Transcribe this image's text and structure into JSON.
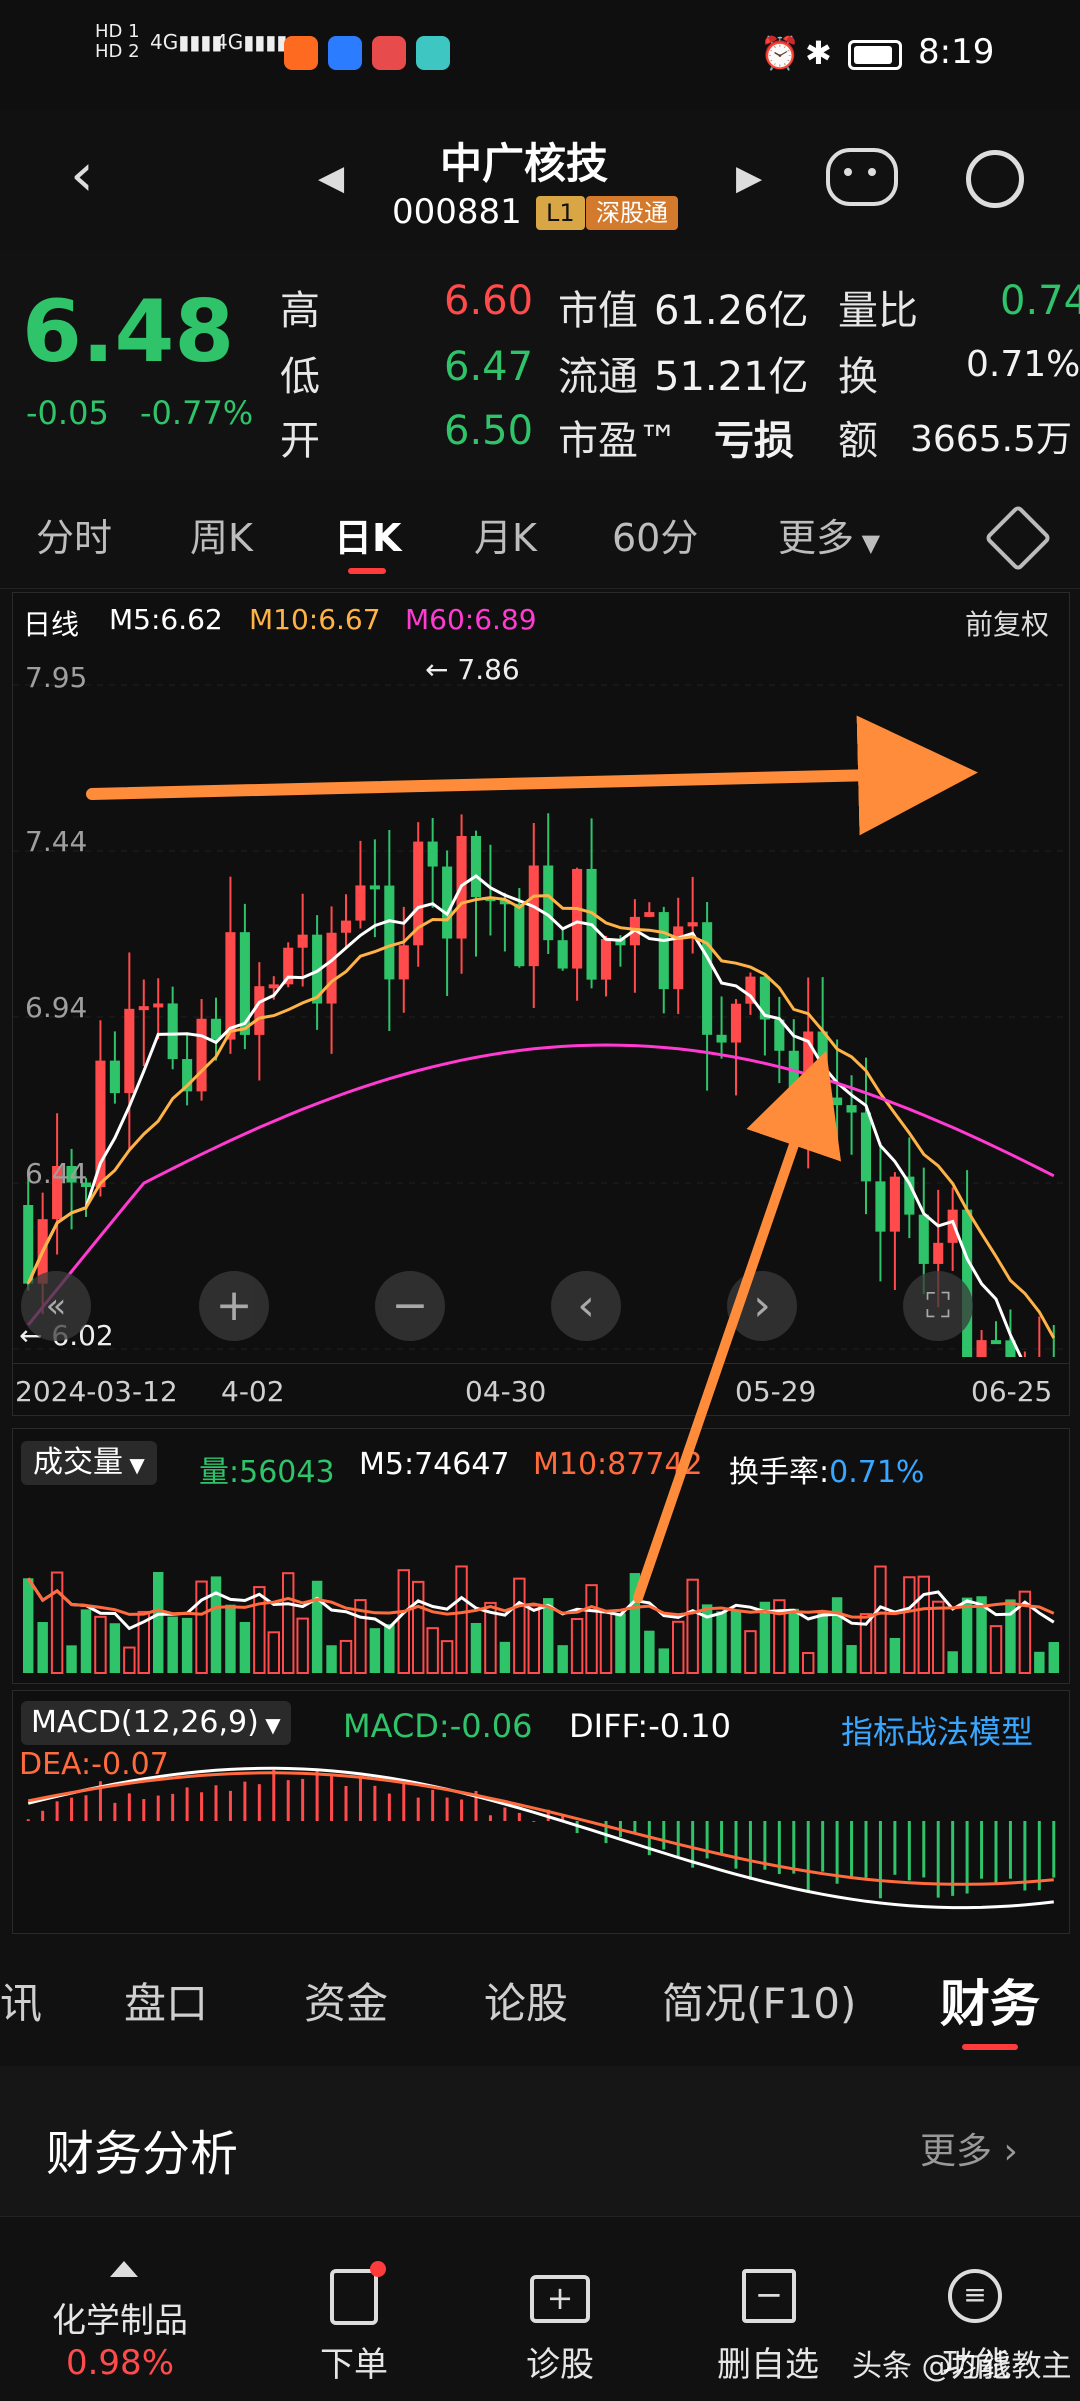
{
  "status_bar": {
    "network": "4G",
    "network2": "4G",
    "time": "8:19",
    "sim1": "HD 1",
    "sim2": "HD 2"
  },
  "header": {
    "stock_name": "中广核技",
    "stock_code": "000881",
    "level_badge": "L1",
    "exchange_badge": "深股通"
  },
  "quote": {
    "price": "6.48",
    "change": "-0.05",
    "change_pct": "-0.77%",
    "high_label": "高",
    "high": "6.60",
    "low_label": "低",
    "low": "6.47",
    "open_label": "开",
    "open": "6.50",
    "mcap_label": "市值",
    "mcap": "61.26亿",
    "float_label": "流通",
    "float": "51.21亿",
    "pe_label": "市盈™",
    "pe": "亏损",
    "vol_ratio_label": "量比",
    "vol_ratio": "0.74",
    "turnover_label": "换",
    "turnover": "0.71%",
    "amount_label": "额",
    "amount": "3665.5万"
  },
  "period_tabs": [
    "分时",
    "周K",
    "日K",
    "月K",
    "60分",
    "更多"
  ],
  "active_period": "日K",
  "kline": {
    "label": "日线",
    "ma5": "M5:6.62",
    "ma10": "M10:6.67",
    "ma60": "M60:6.89",
    "adjust": "前复权",
    "y_ticks": [
      "7.95",
      "7.44",
      "6.94",
      "6.44"
    ],
    "max_marker": "7.86",
    "min_marker": "6.02",
    "dates": [
      "2024-03-12",
      "4-02",
      "04-30",
      "05-29",
      "06-25"
    ]
  },
  "volume": {
    "label": "成交量",
    "vol": "量:56043",
    "ma5": "M5:74647",
    "ma10": "M10:87742",
    "turnover_label": "换手率:",
    "turnover": "0.71%"
  },
  "macd": {
    "label": "MACD(12,26,9)",
    "macd": "MACD:-0.06",
    "diff": "DIFF:-0.10",
    "dea": "DEA:-0.07",
    "model_link": "指标战法模型"
  },
  "bottom_tabs": [
    "讯",
    "盘口",
    "资金",
    "论股",
    "简况(F10)",
    "财务"
  ],
  "active_bottom_tab": "财务",
  "finance": {
    "title": "财务分析",
    "more": "更多"
  },
  "bottom_nav": [
    {
      "label": "化学制品",
      "sub": "0.98%"
    },
    {
      "label": "下单"
    },
    {
      "label": "诊股"
    },
    {
      "label": "删自选"
    },
    {
      "label": "功能"
    }
  ],
  "watermark": "头条 @均线教主",
  "colors": {
    "up": "#ff4b4b",
    "down": "#2fc36a",
    "ma5": "#ffffff",
    "ma10": "#ffb347",
    "ma60": "#ff3bd1",
    "annotation": "#ff8c3a"
  }
}
